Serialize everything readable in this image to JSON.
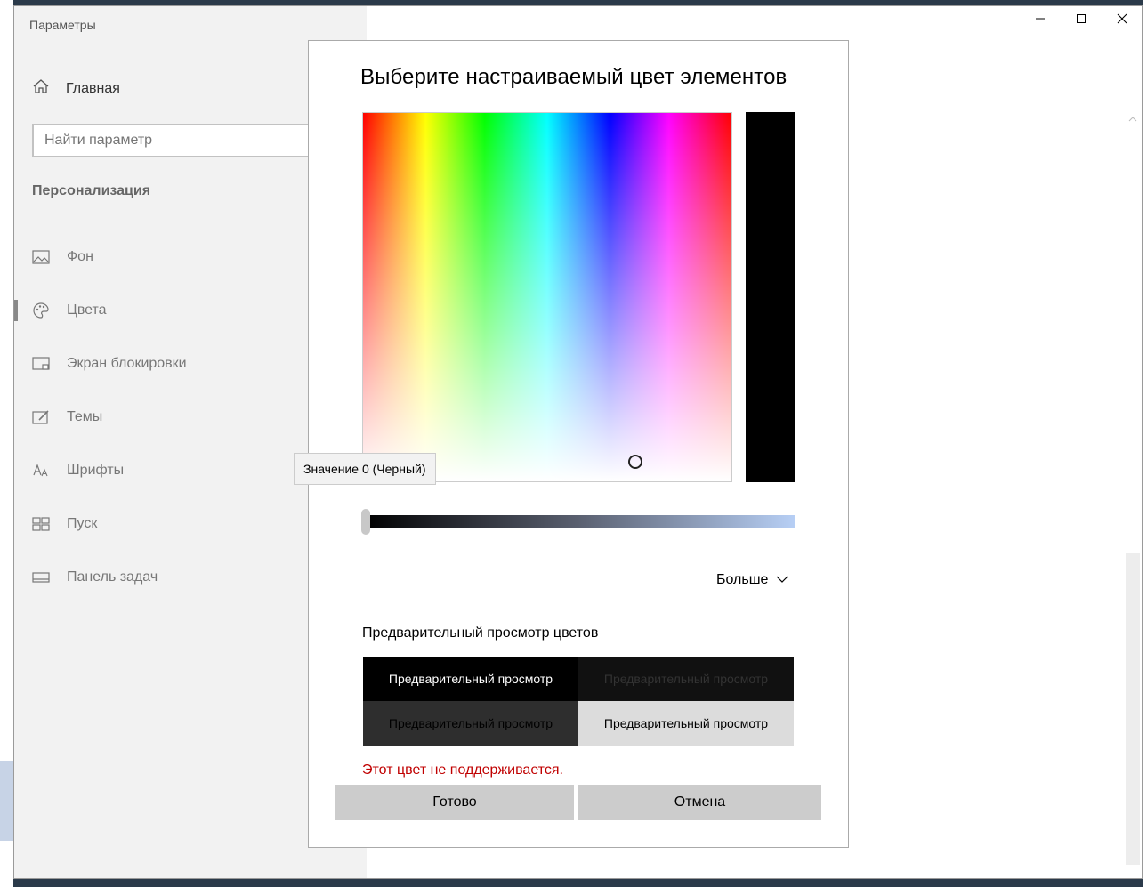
{
  "window": {
    "title": "Параметры"
  },
  "sidebar": {
    "home_label": "Главная",
    "search_placeholder": "Найти параметр",
    "section": "Персонализация",
    "items": [
      {
        "label": "Фон",
        "icon": "picture-icon"
      },
      {
        "label": "Цвета",
        "icon": "palette-icon"
      },
      {
        "label": "Экран блокировки",
        "icon": "lock-screen-icon"
      },
      {
        "label": "Темы",
        "icon": "themes-icon"
      },
      {
        "label": "Шрифты",
        "icon": "fonts-icon"
      },
      {
        "label": "Пуск",
        "icon": "start-icon"
      },
      {
        "label": "Панель задач",
        "icon": "taskbar-icon"
      }
    ]
  },
  "dialog": {
    "title": "Выберите настраиваемый цвет элементов",
    "tooltip": "Значение 0 (Черный)",
    "value_level": 0,
    "more_label": "Больше",
    "preview_heading": "Предварительный просмотр цветов",
    "preview_cells": [
      "Предварительный просмотр",
      "Предварительный просмотр",
      "Предварительный просмотр",
      "Предварительный просмотр"
    ],
    "error": "Этот цвет не поддерживается.",
    "ok_label": "Готово",
    "cancel_label": "Отмена"
  },
  "colors": {
    "selected": "#000000",
    "error": "#c00000",
    "button": "#cccccc"
  }
}
